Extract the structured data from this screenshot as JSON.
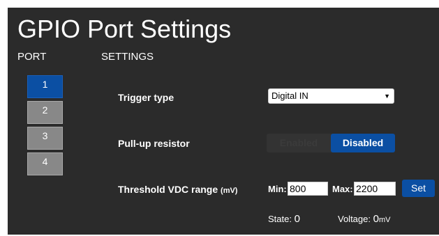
{
  "title": "GPIO Port Settings",
  "port_header": "PORT",
  "settings_header": "SETTINGS",
  "ports": [
    {
      "label": "1",
      "active": true
    },
    {
      "label": "2",
      "active": false
    },
    {
      "label": "3",
      "active": false
    },
    {
      "label": "4",
      "active": false
    }
  ],
  "trigger": {
    "label": "Trigger type",
    "value": "Digital IN"
  },
  "pullup": {
    "label": "Pull-up resistor",
    "enabled_label": "Enabled",
    "disabled_label": "Disabled",
    "selected": "Disabled"
  },
  "threshold": {
    "label": "Threshold VDC range",
    "unit": "(mV)",
    "min_label": "Min:",
    "min_value": "800",
    "max_label": "Max:",
    "max_value": "2200",
    "set_label": "Set"
  },
  "status": {
    "state_label": "State:",
    "state_value": "0",
    "voltage_label": "Voltage:",
    "voltage_value": "0",
    "voltage_unit": "mV"
  },
  "colors": {
    "panel_bg": "#2b2b2b",
    "accent": "#0b4fa3",
    "inactive_port": "#888888"
  }
}
